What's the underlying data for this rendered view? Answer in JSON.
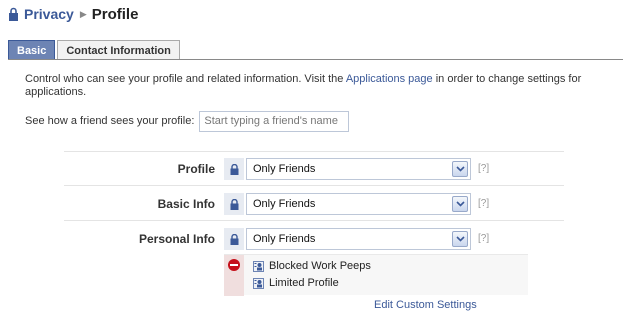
{
  "breadcrumb": {
    "root_label": "Privacy",
    "separator": "▶",
    "current_label": "Profile"
  },
  "tabs": [
    {
      "label": "Basic",
      "active": true
    },
    {
      "label": "Contact Information",
      "active": false
    }
  ],
  "description": {
    "text_before": "Control who can see your profile and related information. Visit the ",
    "link_label": "Applications page",
    "text_after": " in order to change settings for applications."
  },
  "preview": {
    "label": "See how a friend sees your profile:",
    "placeholder": "Start typing a friend's name"
  },
  "settings": [
    {
      "label": "Profile",
      "value": "Only Friends",
      "help": "[?]"
    },
    {
      "label": "Basic Info",
      "value": "Only Friends",
      "help": "[?]"
    },
    {
      "label": "Personal Info",
      "value": "Only Friends",
      "help": "[?]"
    }
  ],
  "custom": {
    "blocked_list": "Blocked Work Peeps",
    "limited_list": "Limited Profile",
    "edit_link": "Edit Custom Settings"
  },
  "colors": {
    "link": "#3b5998",
    "tab_active_bg": "#6d84b4",
    "lock_bg": "#e7ebf2",
    "block_red": "#c5101b"
  },
  "icons": {
    "lock": "lock-icon",
    "dropdown": "chevron-down-icon",
    "block": "no-entry-icon",
    "friend_list": "friend-list-icon"
  }
}
